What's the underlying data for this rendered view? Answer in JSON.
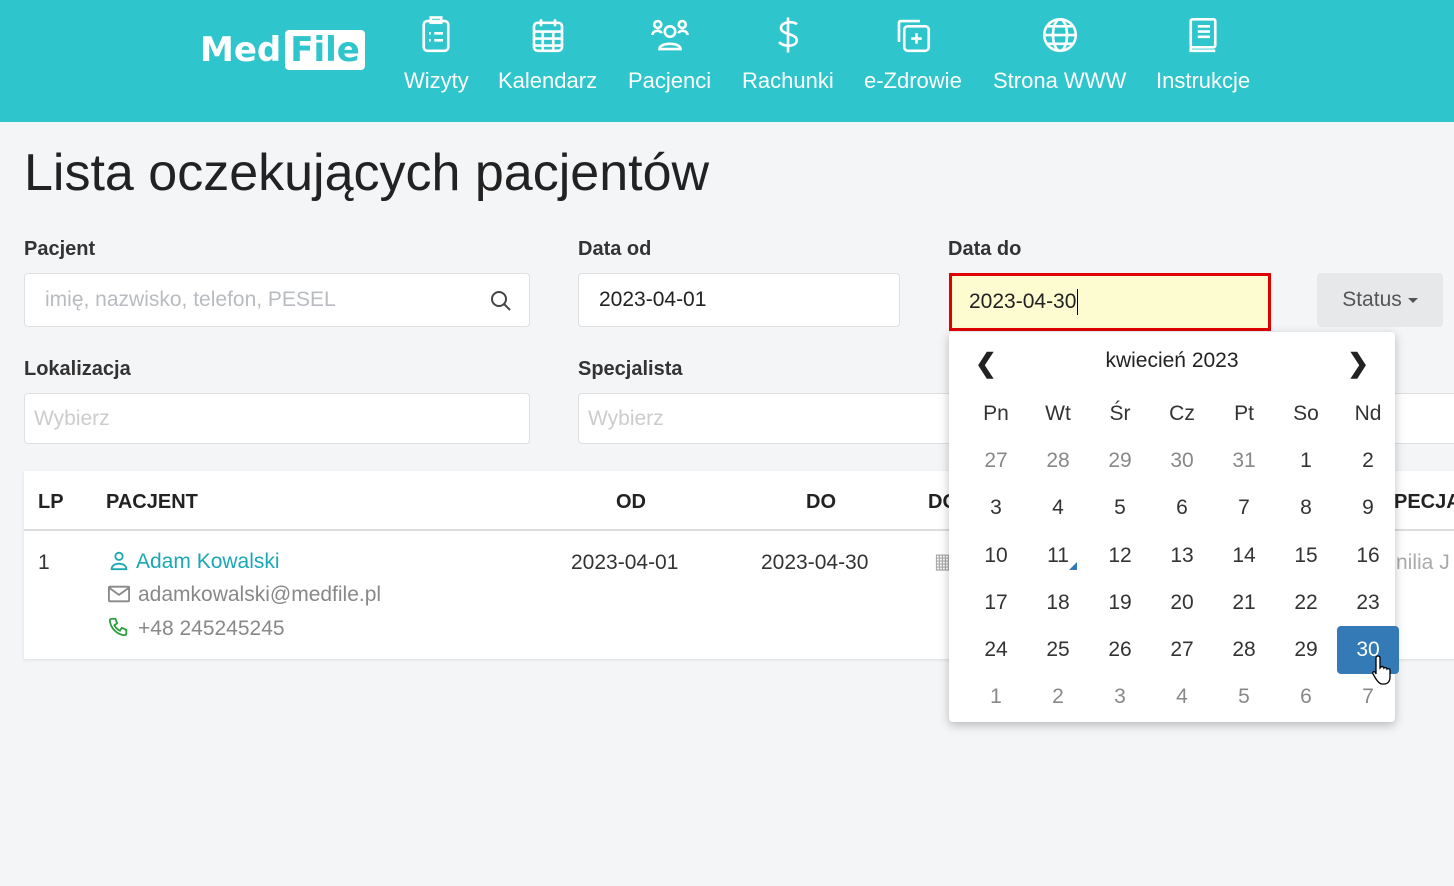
{
  "nav": {
    "logo": "MedFile",
    "logo_a": "Med",
    "logo_b": "File",
    "items": [
      {
        "label": "Wizyty",
        "icon": "clipboard-icon"
      },
      {
        "label": "Kalendarz",
        "icon": "calendar-icon"
      },
      {
        "label": "Pacjenci",
        "icon": "users-icon"
      },
      {
        "label": "Rachunki",
        "icon": "dollar-icon"
      },
      {
        "label": "e-Zdrowie",
        "icon": "medical-plus-icon"
      },
      {
        "label": "Strona WWW",
        "icon": "globe-icon"
      },
      {
        "label": "Instrukcje",
        "icon": "book-icon"
      }
    ]
  },
  "page_title": "Lista oczekujących pacjentów",
  "filters": {
    "patient_label": "Pacjent",
    "patient_placeholder": "imię, nazwisko, telefon, PESEL",
    "date_from_label": "Data od",
    "date_from": "2023-04-01",
    "date_to_label": "Data do",
    "date_to": "2023-04-30",
    "status": "Status",
    "location_label": "Lokalizacja",
    "location_placeholder": "Wybierz",
    "specialist_label": "Specjalista",
    "specialist_placeholder": "Wybierz"
  },
  "table": {
    "headers": {
      "lp": "LP",
      "patient": "PACJENT",
      "from": "OD",
      "to": "DO",
      "d": "DO",
      "spec": "PECJA"
    },
    "rows": [
      {
        "lp": "1",
        "name": "Adam Kowalski",
        "email": "adamkowalski@medfile.pl",
        "phone": "+48 245245245",
        "from": "2023-04-01",
        "to": "2023-04-30",
        "spec": "nilia J"
      }
    ]
  },
  "calendar": {
    "month": "kwiecień 2023",
    "weekdays": [
      "Pn",
      "Wt",
      "Śr",
      "Cz",
      "Pt",
      "So",
      "Nd"
    ],
    "days": [
      "27",
      "28",
      "29",
      "30",
      "31",
      "1",
      "2",
      "3",
      "4",
      "5",
      "6",
      "7",
      "8",
      "9",
      "10",
      "11",
      "12",
      "13",
      "14",
      "15",
      "16",
      "17",
      "18",
      "19",
      "20",
      "21",
      "22",
      "23",
      "24",
      "25",
      "26",
      "27",
      "28",
      "29",
      "30",
      "1",
      "2",
      "3",
      "4",
      "5",
      "6",
      "7"
    ],
    "selected": "30",
    "today": "11",
    "accent": "#337ab7"
  },
  "colors": {
    "brand": "#2ec5cc",
    "highlight": "#fdfbd0",
    "focus_border": "#e00000"
  }
}
